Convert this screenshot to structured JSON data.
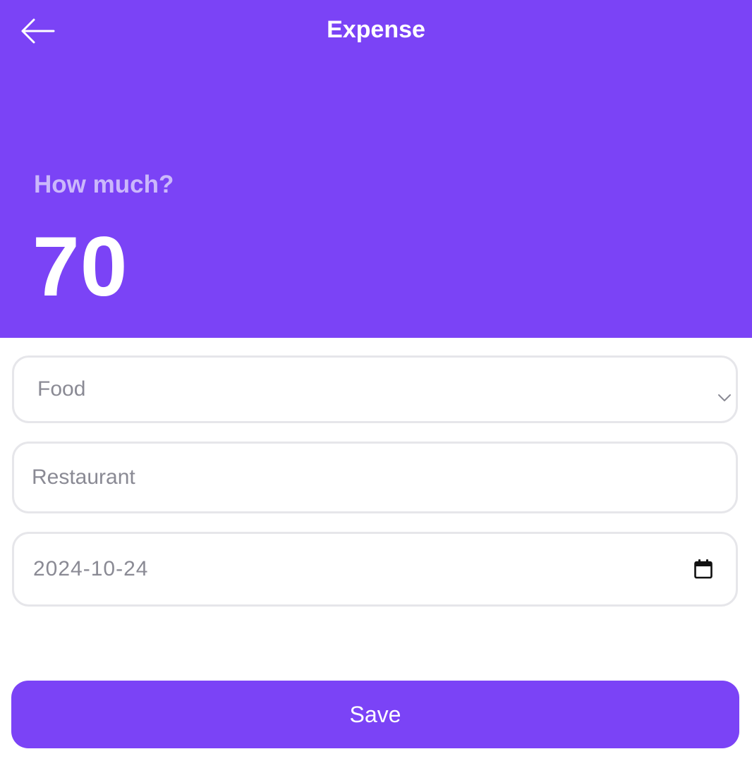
{
  "header": {
    "title": "Expense",
    "back_icon": "arrow-left-icon",
    "background_color": "#7b43f6"
  },
  "amount": {
    "label": "How much?",
    "value": "70"
  },
  "form": {
    "category": {
      "selected": "Food",
      "icon": "chevron-down-icon"
    },
    "description": {
      "value": "Restaurant"
    },
    "date": {
      "value": "2024-10-24",
      "icon": "calendar-icon"
    }
  },
  "actions": {
    "save_label": "Save"
  },
  "colors": {
    "accent": "#7b43f6",
    "label_muted": "#cbb8fb",
    "field_text": "#8a8a94",
    "field_border": "#e6e6ea"
  }
}
